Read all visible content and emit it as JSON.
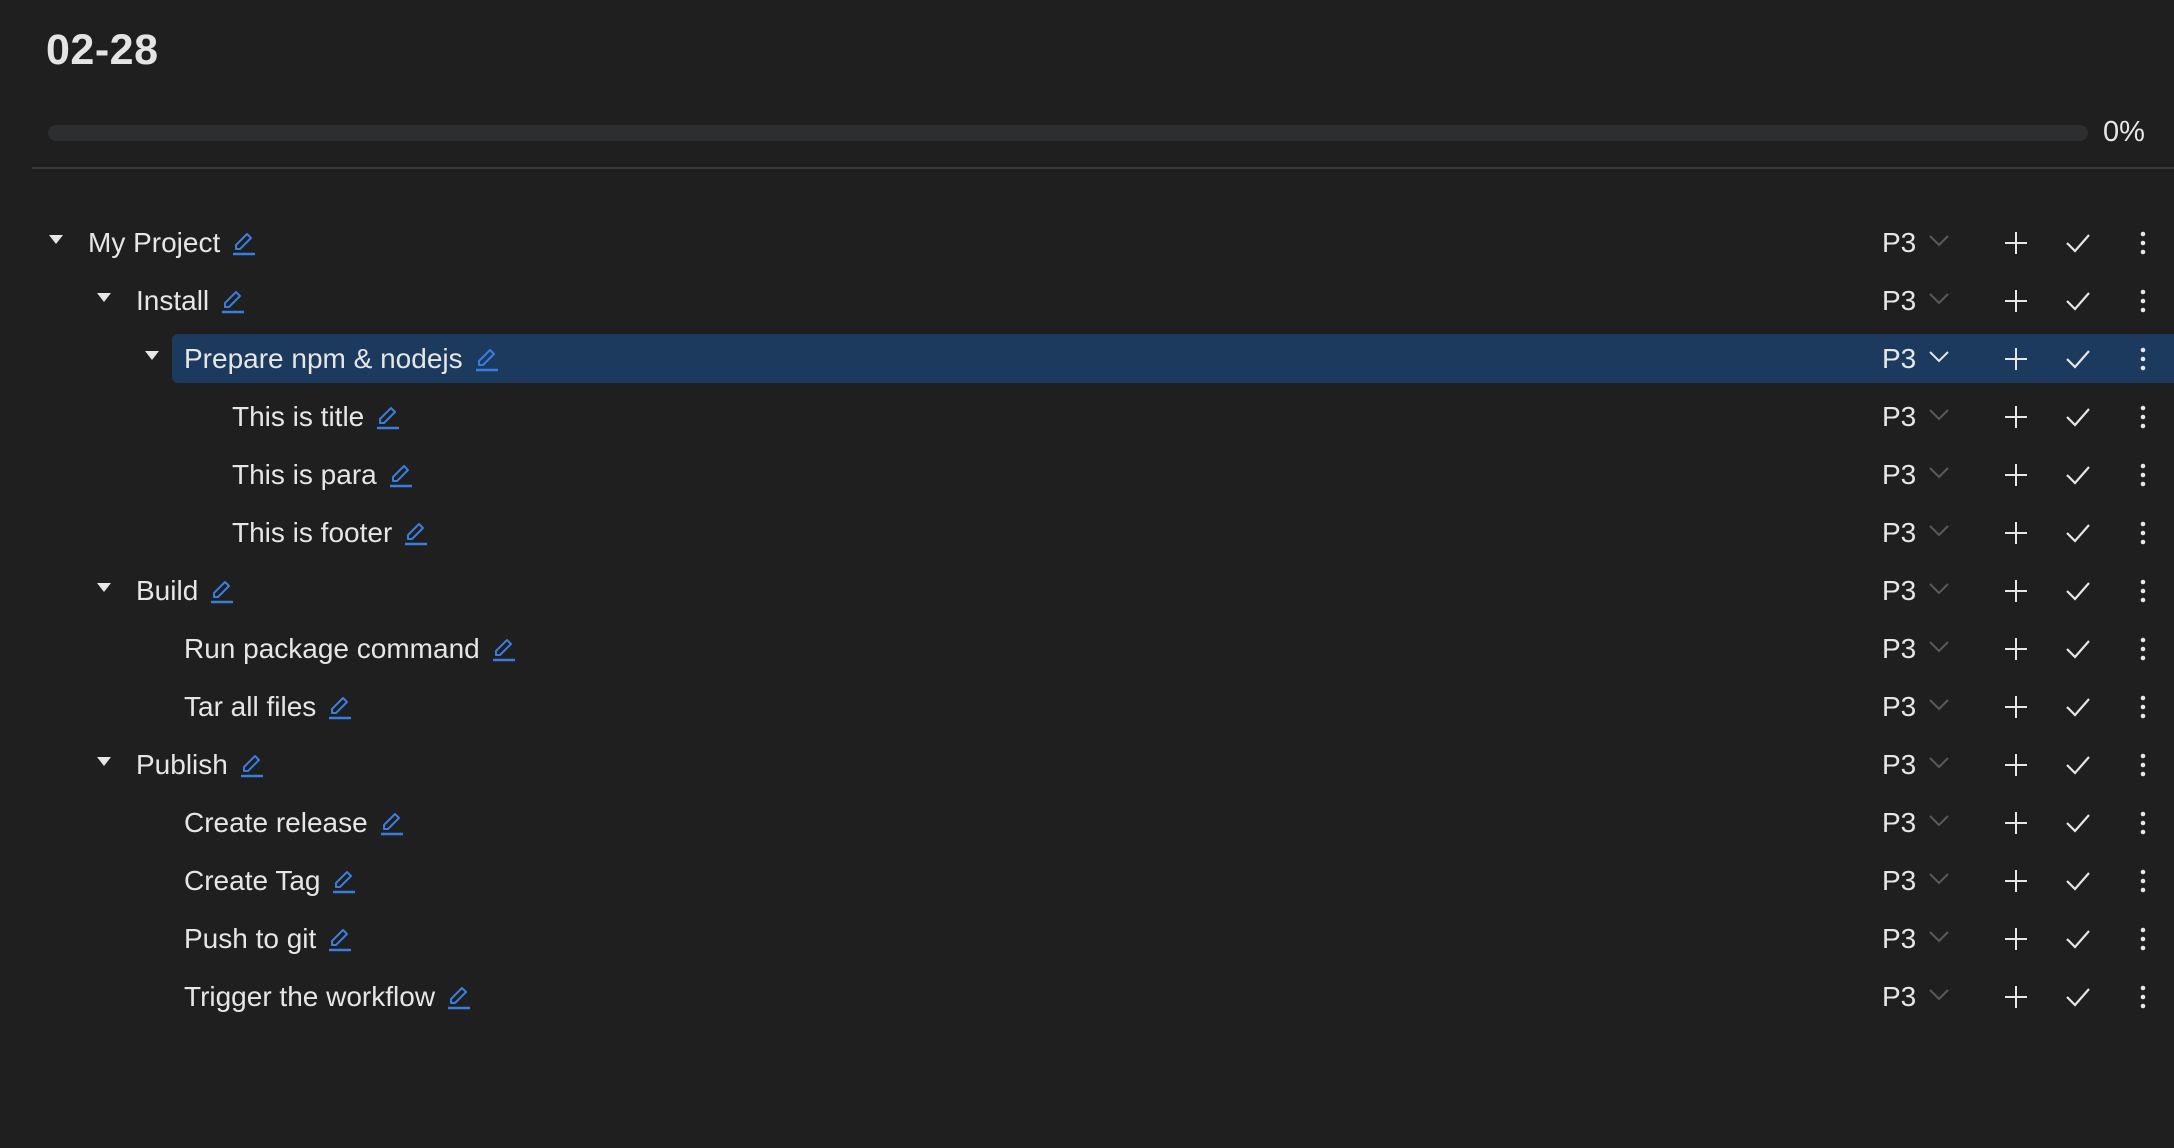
{
  "header": {
    "title": "02-28"
  },
  "progress": {
    "percent": 0,
    "label": "0%"
  },
  "colors": {
    "background": "#1f1f1f",
    "selected_row": "#1b3a5e",
    "edit_icon": "#3b7ddd",
    "progress_track": "#2c2e30"
  },
  "icons": {
    "toggle": "caret-down-icon",
    "edit": "pencil-icon",
    "priority_dropdown": "chevron-down-icon",
    "add": "plus-icon",
    "complete": "check-icon",
    "more": "more-vertical-icon"
  },
  "tasks": [
    {
      "title": "My Project",
      "level": 0,
      "expandable": true,
      "priority": "P3",
      "selected": false
    },
    {
      "title": "Install",
      "level": 1,
      "expandable": true,
      "priority": "P3",
      "selected": false
    },
    {
      "title": "Prepare npm & nodejs",
      "level": 2,
      "expandable": true,
      "priority": "P3",
      "selected": true
    },
    {
      "title": "This is title",
      "level": 3,
      "expandable": false,
      "priority": "P3",
      "selected": false
    },
    {
      "title": "This is para",
      "level": 3,
      "expandable": false,
      "priority": "P3",
      "selected": false
    },
    {
      "title": "This is footer",
      "level": 3,
      "expandable": false,
      "priority": "P3",
      "selected": false
    },
    {
      "title": "Build",
      "level": 1,
      "expandable": true,
      "priority": "P3",
      "selected": false
    },
    {
      "title": "Run package command",
      "level": 2,
      "expandable": false,
      "priority": "P3",
      "selected": false
    },
    {
      "title": "Tar all files",
      "level": 2,
      "expandable": false,
      "priority": "P3",
      "selected": false
    },
    {
      "title": "Publish",
      "level": 1,
      "expandable": true,
      "priority": "P3",
      "selected": false
    },
    {
      "title": "Create release",
      "level": 2,
      "expandable": false,
      "priority": "P3",
      "selected": false
    },
    {
      "title": "Create Tag",
      "level": 2,
      "expandable": false,
      "priority": "P3",
      "selected": false
    },
    {
      "title": "Push to git",
      "level": 2,
      "expandable": false,
      "priority": "P3",
      "selected": false
    },
    {
      "title": "Trigger the workflow",
      "level": 2,
      "expandable": false,
      "priority": "P3",
      "selected": false
    }
  ]
}
